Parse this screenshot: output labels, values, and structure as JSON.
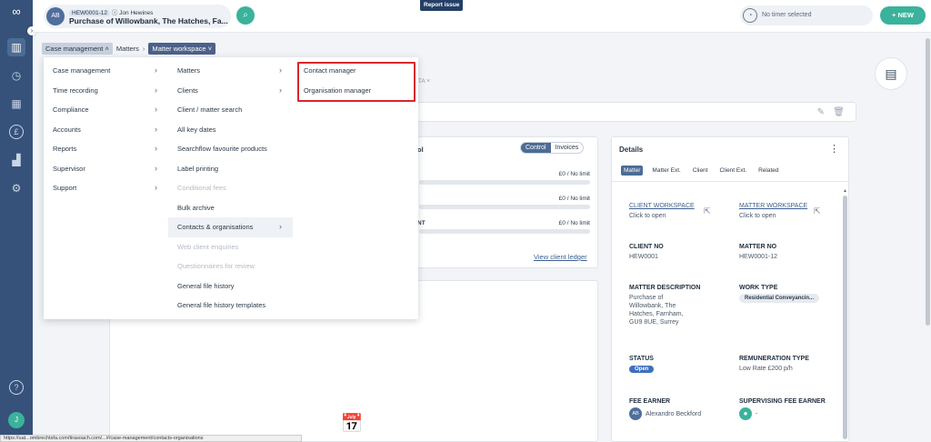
{
  "header": {
    "matter_avatar": "AB",
    "matter_ref": "HEW0001-12",
    "matter_owner": "Jon Hewines",
    "matter_title": "Purchase of Willowbank, The Hatches, Fa...",
    "report_issue": "Report issue",
    "timer_text": "No timer selected",
    "new_label": "+ NEW"
  },
  "breadcrumb": {
    "item1": "Case management",
    "item2": "Matters",
    "item3": "Matter workspace"
  },
  "menu": {
    "col1": [
      {
        "label": "Case management",
        "arrow": true
      },
      {
        "label": "Time recording",
        "arrow": true
      },
      {
        "label": "Compliance",
        "arrow": true
      },
      {
        "label": "Accounts",
        "arrow": true
      },
      {
        "label": "Reports",
        "arrow": true
      },
      {
        "label": "Supervisor",
        "arrow": true
      },
      {
        "label": "Support",
        "arrow": true
      }
    ],
    "col2": [
      {
        "label": "Matters",
        "arrow": true,
        "disabled": false
      },
      {
        "label": "Clients",
        "arrow": true,
        "disabled": false
      },
      {
        "label": "Client / matter search",
        "arrow": false,
        "disabled": false
      },
      {
        "label": "All key dates",
        "arrow": false,
        "disabled": false
      },
      {
        "label": "Searchflow favourite products",
        "arrow": false,
        "disabled": false
      },
      {
        "label": "Label printing",
        "arrow": false,
        "disabled": false
      },
      {
        "label": "Conditional fees",
        "arrow": false,
        "disabled": true
      },
      {
        "label": "Bulk archive",
        "arrow": false,
        "disabled": false
      },
      {
        "label": "Contacts & organisations",
        "arrow": true,
        "disabled": false
      },
      {
        "label": "Web client enquiries",
        "arrow": false,
        "disabled": true
      },
      {
        "label": "Questionnaires for review",
        "arrow": false,
        "disabled": true
      },
      {
        "label": "General file history",
        "arrow": false,
        "disabled": false
      },
      {
        "label": "General file history templates",
        "arrow": false,
        "disabled": false
      }
    ],
    "col3": [
      {
        "label": "Contact manager"
      },
      {
        "label": "Organisation manager"
      }
    ]
  },
  "background": {
    "partial_label": "ATA",
    "fin_title_partial": "ol",
    "control_label": "Control",
    "invoices_label": "Invoices",
    "fin_rows": [
      {
        "label": "",
        "amount": "£0 / No limit"
      },
      {
        "label": "",
        "amount": "£0 / No limit"
      },
      {
        "label": "NT",
        "amount": "£0 / No limit"
      }
    ],
    "view_ledger": "View client ledger"
  },
  "details": {
    "title": "Details",
    "tabs": [
      "Matter",
      "Matter Ext.",
      "Client",
      "Client Ext.",
      "Related"
    ],
    "client_workspace": "CLIENT WORKSPACE",
    "client_workspace_sub": "Click to open",
    "matter_workspace": "MATTER WORKSPACE",
    "matter_workspace_sub": "Click to open",
    "client_no_label": "CLIENT NO",
    "client_no": "HEW0001",
    "matter_no_label": "MATTER NO",
    "matter_no": "HEW0001-12",
    "matter_desc_label": "MATTER DESCRIPTION",
    "matter_desc": "Purchase of Willowbank, The Hatches, Farnham, GU9 8UE, Surrey",
    "work_type_label": "WORK TYPE",
    "work_type": "Residential Conveyancin...",
    "status_label": "STATUS",
    "status": "Open",
    "remuneration_label": "REMUNERATION TYPE",
    "remuneration": "Low Rate £200 p/h",
    "fee_earner_label": "FEE EARNER",
    "fee_earner_avatar": "AB",
    "fee_earner": "Alexandro Beckford",
    "supervising_label": "SUPERVISING FEE EARNER",
    "supervising": "-"
  },
  "user_initial": "J",
  "status_url": "https://uat...ombrechtsfa.com/tirasoach.com/...#/case-management/contacts-organisations"
}
